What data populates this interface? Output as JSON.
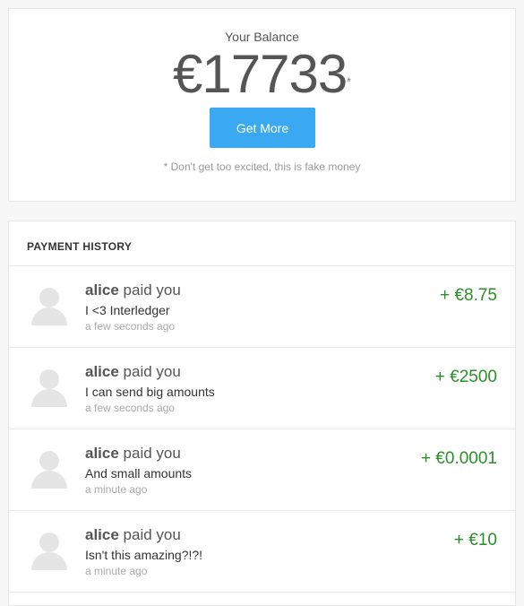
{
  "balance": {
    "label": "Your Balance",
    "amount": "€17733",
    "asterisk": "*",
    "button_label": "Get More",
    "note": "* Don't get too excited, this is fake money"
  },
  "history": {
    "title": "PAYMENT HISTORY",
    "payments": [
      {
        "sender": "alice",
        "verb": "paid you",
        "message": "I <3 Interledger",
        "time": "a few seconds ago",
        "amount": "+ €8.75"
      },
      {
        "sender": "alice",
        "verb": "paid you",
        "message": "I can send big amounts",
        "time": "a few seconds ago",
        "amount": "+ €2500"
      },
      {
        "sender": "alice",
        "verb": "paid you",
        "message": "And small amounts",
        "time": "a minute ago",
        "amount": "+ €0.0001"
      },
      {
        "sender": "alice",
        "verb": "paid you",
        "message": "Isn't this amazing?!?!",
        "time": "a minute ago",
        "amount": "+ €10"
      }
    ]
  },
  "colors": {
    "accent": "#3ba9f1",
    "positive": "#2a8f2a"
  },
  "icons": {
    "avatar": "user-avatar-icon"
  }
}
